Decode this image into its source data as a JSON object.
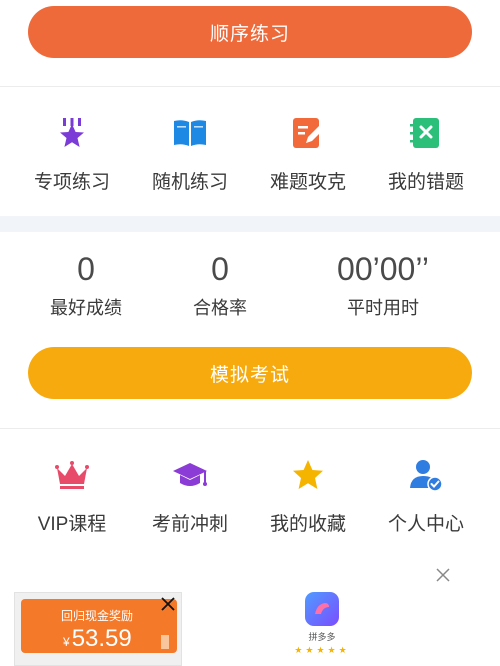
{
  "buttons": {
    "order_practice": "顺序练习",
    "mock_exam": "模拟考试"
  },
  "menu_top": [
    {
      "label": "专项练习",
      "icon": "star-badge-icon",
      "color": "#7b3bd6"
    },
    {
      "label": "随机练习",
      "icon": "open-book-icon",
      "color": "#1e88e5"
    },
    {
      "label": "难题攻克",
      "icon": "edit-pencil-icon",
      "color": "#f26a3a"
    },
    {
      "label": "我的错题",
      "icon": "wrong-notebook-icon",
      "color": "#2bbf7a"
    }
  ],
  "stats": [
    {
      "value": "0",
      "label": "最好成绩"
    },
    {
      "value": "0",
      "label": "合格率"
    },
    {
      "value": "00’00’’",
      "label": "平时用时"
    }
  ],
  "menu_bottom": [
    {
      "label": "VIP课程",
      "icon": "crown-icon",
      "color": "#e84b6a"
    },
    {
      "label": "考前冲刺",
      "icon": "graduation-cap-icon",
      "color": "#8b3bd6"
    },
    {
      "label": "我的收藏",
      "icon": "star-icon",
      "color": "#f5b400"
    },
    {
      "label": "个人中心",
      "icon": "user-check-icon",
      "color": "#2f7de1"
    }
  ],
  "ad": {
    "promo_title": "回归现金奖励",
    "currency": "¥",
    "amount": "53.59",
    "app_name": "拼多多",
    "stars": "★★★★★"
  }
}
